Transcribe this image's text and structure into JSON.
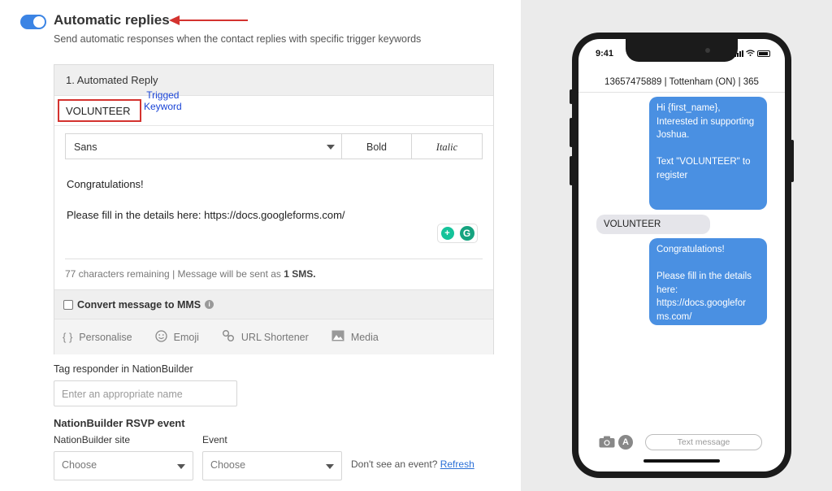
{
  "header": {
    "title": "Automatic replies",
    "subtitle": "Send automatic responses when the contact replies with specific trigger keywords",
    "accent_color": "#3b84e4",
    "annotation_color": "#d4332f"
  },
  "reply_card": {
    "title": "1. Automated Reply",
    "keyword": "VOLUNTEER",
    "keyword_note_line1": "Trigged",
    "keyword_note_line2": "Keyword",
    "font_select": "Sans",
    "bold_label": "Bold",
    "italic_label": "Italic",
    "message_line1": "Congratulations!",
    "message_line2": "Please fill in the details here: https://docs.googleforms.com/",
    "char_info_prefix": "77 characters remaining | Message will be sent as ",
    "char_info_count": "1 SMS.",
    "mms_label": "Convert message to MMS",
    "mms_checked": false,
    "tools": [
      {
        "label": "Personalise",
        "icon": "braces-icon"
      },
      {
        "label": "Emoji",
        "icon": "smiley-icon"
      },
      {
        "label": "URL Shortener",
        "icon": "link-icon"
      },
      {
        "label": "Media",
        "icon": "image-icon"
      }
    ]
  },
  "tag_responder": {
    "label": "Tag responder in NationBuilder",
    "placeholder": "Enter an appropriate name"
  },
  "rsvp": {
    "title": "NationBuilder RSVP event",
    "site_label": "NationBuilder site",
    "site_value": "Choose",
    "event_label": "Event",
    "event_value": "Choose",
    "dont_see_text": "Don't see an event?",
    "refresh_link": "Refresh"
  },
  "phone": {
    "time": "9:41",
    "contact": "13657475889 | Tottenham (ON) | 365",
    "messages": [
      {
        "direction": "out",
        "text": "Hi {first_name},\nInterested in supporting  Joshua.\n\nText \"VOLUNTEER\" to register"
      },
      {
        "direction": "in",
        "text": "VOLUNTEER"
      },
      {
        "direction": "out",
        "text": "Congratulations!\n\nPlease fill in the details here:\nhttps://docs.googlefor ms.com/"
      }
    ],
    "input_placeholder": "Text message",
    "outgoing_color": "#4a90e2",
    "incoming_color": "#e5e5ea"
  }
}
